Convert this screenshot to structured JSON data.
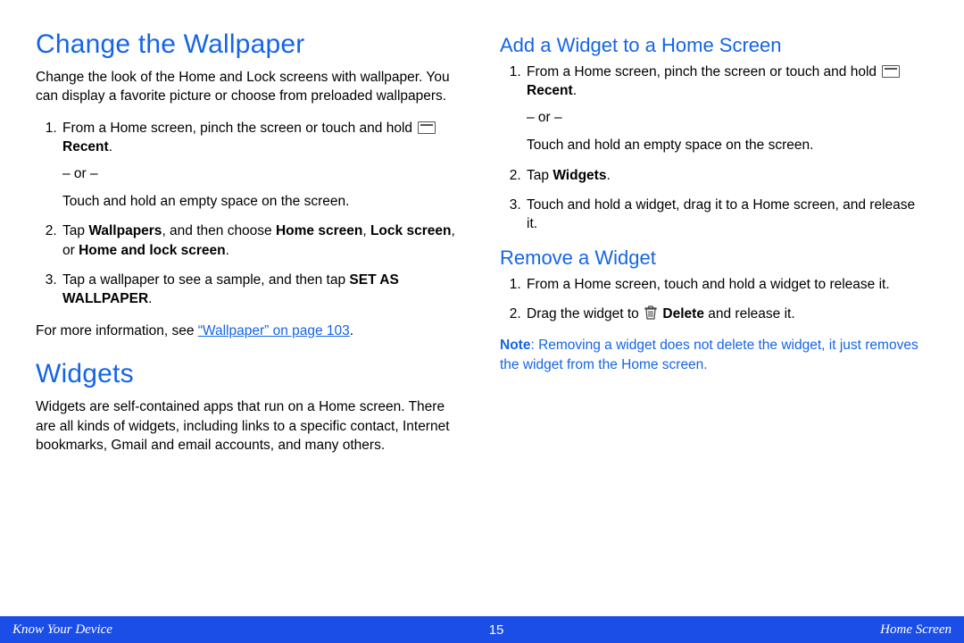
{
  "left": {
    "h_wallpaper": "Change the Wallpaper",
    "wallpaper_intro": "Change the look of the Home and Lock screens with wallpaper. You can display a favorite picture or choose from preloaded wallpapers.",
    "step1a": "From a Home screen, pinch the screen or touch and hold ",
    "recent": "Recent",
    "step1b": ".",
    "or": "– or –",
    "step1c": "Touch and hold an empty space on the screen.",
    "step2a": "Tap ",
    "wallpapers": "Wallpapers",
    "step2b": ", and then choose ",
    "homescreen": "Home screen",
    "step2c": ", ",
    "lockscreen": "Lock screen",
    "step2d": ", or ",
    "homeandlock": "Home and lock screen",
    "step2e": ".",
    "step3a": "Tap a wallpaper to see a sample, and then tap ",
    "setas": "SET AS WALLPAPER",
    "step3b": ".",
    "moreinfo_a": "For more information, see ",
    "moreinfo_link": "“Wallpaper” on page 103",
    "moreinfo_b": ".",
    "h_widgets": "Widgets",
    "widgets_intro": "Widgets are self-contained apps that run on a Home screen. There are all kinds of widgets, including links to a specific contact, Internet bookmarks, Gmail and email accounts, and many others."
  },
  "right": {
    "h_add": "Add a Widget to a Home Screen",
    "add1a": "From a Home screen, pinch the screen or touch and hold ",
    "recent": "Recent",
    "add1b": ".",
    "or": "– or –",
    "add1c": "Touch and hold an empty space on the screen.",
    "add2a": "Tap ",
    "widgets": "Widgets",
    "add2b": ".",
    "add3": "Touch and hold a widget, drag it to a Home screen, and release it.",
    "h_remove": "Remove a Widget",
    "rem1": "From a Home screen, touch and hold a widget to release it.",
    "rem2a": "Drag the widget to ",
    "delete": "Delete",
    "rem2b": " and release it.",
    "note_label": "Note",
    "note_body": ": Removing a widget does not delete the widget, it just removes the widget from the Home screen."
  },
  "footer": {
    "left": "Know Your Device",
    "center": "15",
    "right": "Home Screen"
  }
}
